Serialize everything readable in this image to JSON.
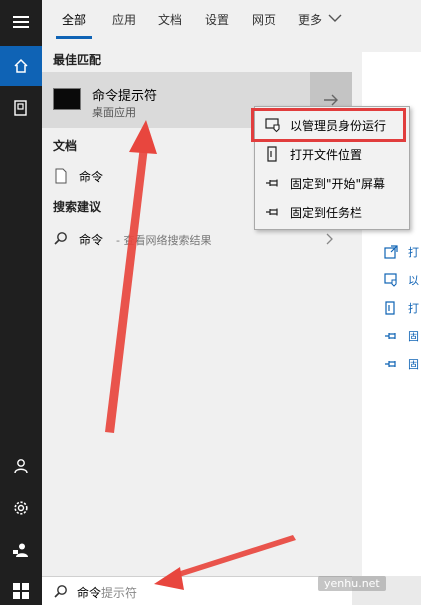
{
  "tabs": {
    "all": "全部",
    "apps": "应用",
    "docs": "文档",
    "settings": "设置",
    "web": "网页",
    "more": "更多"
  },
  "sections": {
    "best_match": "最佳匹配",
    "documents": "文档",
    "suggestions": "搜索建议"
  },
  "best_match": {
    "title": "命令提示符",
    "subtitle": "桌面应用"
  },
  "document_item": {
    "label": "命令"
  },
  "suggestion": {
    "label": "命令",
    "hint": "- 查看网络搜索结果"
  },
  "context_menu": {
    "items": [
      {
        "label": "以管理员身份运行",
        "icon": "shield-window-icon"
      },
      {
        "label": "打开文件位置",
        "icon": "file-location-icon"
      },
      {
        "label": "固定到\"开始\"屏幕",
        "icon": "pin-icon"
      },
      {
        "label": "固定到任务栏",
        "icon": "pin-icon"
      }
    ]
  },
  "preview": {
    "items": [
      {
        "label": "打"
      },
      {
        "label": "以"
      },
      {
        "label": "打"
      },
      {
        "label": "固"
      },
      {
        "label": "固"
      }
    ]
  },
  "search": {
    "typed": "命令",
    "ghost": "提示符"
  },
  "watermark": "yenhu.net",
  "colors": {
    "accent": "#0f63b5",
    "rail": "#1f1f1f",
    "highlight_box": "#e13d3d",
    "arrow": "#e8463e"
  }
}
